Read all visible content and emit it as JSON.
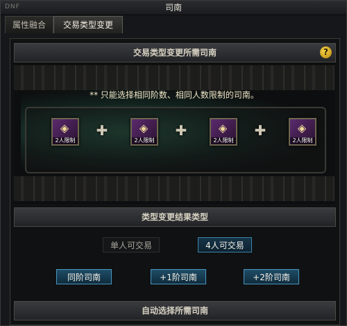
{
  "window": {
    "title": "司南"
  },
  "tabs": [
    {
      "label": "属性融合"
    },
    {
      "label": "交易类型变更"
    }
  ],
  "section1": {
    "header": "交易类型变更所需司南",
    "help_icon": "?",
    "notice": "** 只能选择相同阶数、相同人数限制的司南。",
    "items": [
      {
        "label": "2人限制"
      },
      {
        "label": "2人限制"
      },
      {
        "label": "2人限制"
      },
      {
        "label": "2人限制"
      }
    ]
  },
  "section2": {
    "header": "类型变更结果类型",
    "options": [
      {
        "label": "单人可交易"
      },
      {
        "label": "4人可交易"
      }
    ],
    "tiers": [
      {
        "label": "同阶司南"
      },
      {
        "label": "+1阶司南"
      },
      {
        "label": "+2阶司南"
      }
    ]
  },
  "section3": {
    "header": "自动选择所需司南"
  },
  "colors": {
    "accent_blue": "#3e83a8",
    "gold": "#f7d54a",
    "panel_bg": "#101113"
  },
  "icons": {
    "help": "help-icon",
    "plus": "plus-icon",
    "item": "compass-item-icon"
  }
}
